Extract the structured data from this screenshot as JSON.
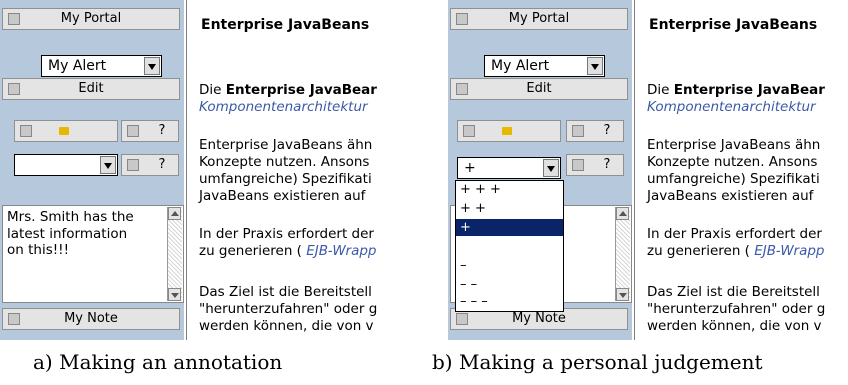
{
  "panel_a": {
    "sidebar": {
      "my_portal": "My Portal",
      "my_alert_select": "My Alert",
      "edit": "Edit",
      "help": "?",
      "rating_select": "",
      "note_text": [
        "Mrs. Smith has the",
        "latest information",
        "on this!!!"
      ],
      "my_note": "My Note"
    },
    "content": {
      "title": "Enterprise JavaBeans",
      "p1_prefix": "Die ",
      "p1_bold": "Enterprise JavaBear",
      "p1_ital": "Komponentenarchitektur",
      "p2": [
        "Enterprise JavaBeans ähn",
        "Konzepte nutzen. Ansons",
        "umfangreiche) Spezifikati",
        "JavaBeans existieren auf"
      ],
      "p3_line1": "In der Praxis erfordert der",
      "p3_line2_prefix": "zu generieren ( ",
      "p3_line2_ital": "EJB-Wrapp",
      "p4": [
        "Das Ziel ist die Bereitstell",
        "\"herunterzufahren\" oder g",
        "werden können, die von v"
      ]
    },
    "caption": "a) Making an annotation"
  },
  "panel_b": {
    "sidebar": {
      "my_portal": "My Portal",
      "my_alert_select": "My Alert",
      "edit": "Edit",
      "help": "?",
      "rating_select": "+",
      "my_note": "My Note"
    },
    "rating_options": [
      "+ + +",
      "+ +",
      "+",
      "",
      "–",
      "– –",
      "– – –"
    ],
    "rating_selected_index": 2,
    "content": {
      "title": "Enterprise JavaBeans",
      "p1_prefix": "Die ",
      "p1_bold": "Enterprise JavaBear",
      "p1_ital": "Komponentenarchitektur",
      "p2": [
        "Enterprise JavaBeans ähn",
        "Konzepte nutzen. Ansons",
        "umfangreiche) Spezifikati",
        "JavaBeans existieren auf"
      ],
      "p3_line1": "In der Praxis erfordert der",
      "p3_line2_prefix": "zu generieren ( ",
      "p3_line2_ital": "EJB-Wrapp",
      "p4": [
        "Das Ziel ist die Bereitstell",
        "\"herunterzufahren\" oder g",
        "werden können, die von v"
      ]
    },
    "caption": "b) Making a personal judgement"
  },
  "colors": {
    "sidebar": "#b6c8dc",
    "selection": "#0a246a",
    "link_italic": "#3c5aa8"
  }
}
